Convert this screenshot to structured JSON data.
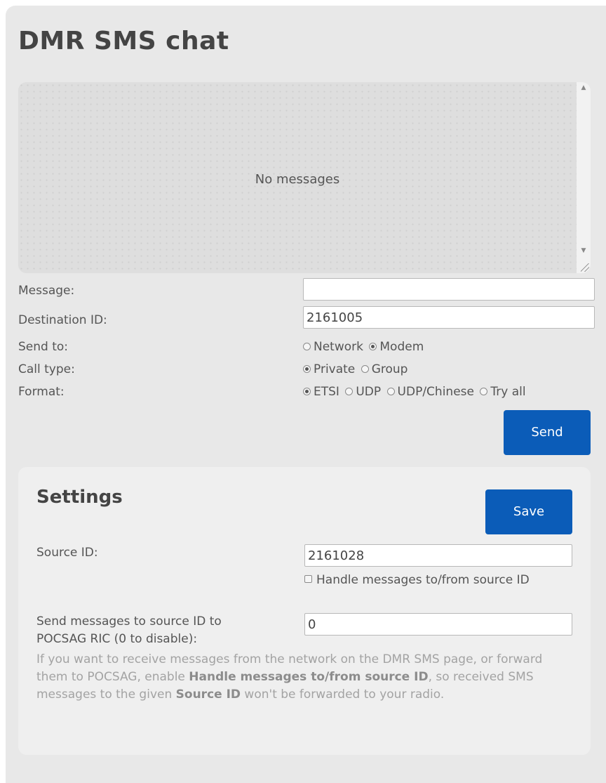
{
  "page": {
    "title": "DMR SMS chat"
  },
  "chat": {
    "empty_text": "No messages"
  },
  "form": {
    "message_label": "Message:",
    "message_value": "",
    "destination_label": "Destination ID:",
    "destination_value": "2161005",
    "send_to_label": "Send to:",
    "send_to_options": [
      {
        "label": "Network",
        "selected": false
      },
      {
        "label": "Modem",
        "selected": true
      }
    ],
    "call_type_label": "Call type:",
    "call_type_options": [
      {
        "label": "Private",
        "selected": true
      },
      {
        "label": "Group",
        "selected": false
      }
    ],
    "format_label": "Format:",
    "format_options": [
      {
        "label": "ETSI",
        "selected": true
      },
      {
        "label": "UDP",
        "selected": false
      },
      {
        "label": "UDP/Chinese",
        "selected": false
      },
      {
        "label": "Try all",
        "selected": false
      }
    ],
    "send_button": "Send"
  },
  "settings": {
    "title": "Settings",
    "save_button": "Save",
    "source_id_label": "Source ID:",
    "source_id_value": "2161028",
    "handle_checkbox_label": "Handle messages to/from source ID",
    "handle_checkbox_checked": false,
    "pocsag_label_line1": "Send messages to source ID to",
    "pocsag_label_line2": "POCSAG RIC (0 to disable):",
    "pocsag_value": "0",
    "help_part1": "If you want to receive messages from the network on the DMR SMS page, or forward them to POCSAG, enable ",
    "help_bold1": "Handle messages to/from source ID",
    "help_part2": ", so received SMS messages to the given ",
    "help_bold2": "Source ID",
    "help_part3": " won't be forwarded to your radio."
  },
  "colors": {
    "accent": "#0b5cb8",
    "panel_bg": "#e8e8e8",
    "settings_bg": "#efefef"
  }
}
